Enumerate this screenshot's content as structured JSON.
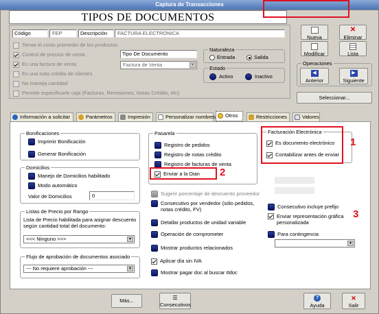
{
  "window": {
    "title": "Captura de Transacciones",
    "heading": "TIPOS DE DOCUMENTOS"
  },
  "header": {
    "codigo_label": "Código",
    "codigo_value": "FEP",
    "descripcion_label": "Descripción",
    "descripcion_value": "FACTURA ELECTRONICA"
  },
  "options": [
    {
      "label": "Tomar el costo promedio de los productos",
      "checked": false
    },
    {
      "label": "Control de precios de venta",
      "checked": true
    },
    {
      "label": "Es una factura de venta",
      "checked": true
    },
    {
      "label": "Es una nota crédito de clientes",
      "checked": false
    },
    {
      "label": "No maneja cantidad",
      "checked": false
    },
    {
      "label": "Permitir especificarle caja (Facturas, Remisiones, Notas Crédito, etc)",
      "checked": false
    }
  ],
  "tipo_documento": {
    "label": "Tipo De Documento",
    "value": "Factura de Venta"
  },
  "naturaleza": {
    "label": "Naturaleza",
    "options": [
      "Entrada",
      "Salida"
    ],
    "selected": "Salida"
  },
  "estado": {
    "label": "Estado",
    "options": [
      "Activo",
      "Inactivo"
    ]
  },
  "toolbar": {
    "nueva": "Nueva",
    "eliminar": "Eliminar",
    "modificar": "Modificar",
    "lista": "Lista"
  },
  "operaciones": {
    "label": "Operaciones",
    "anterior": "Anterior",
    "siguiente": "Siguiente"
  },
  "seleccionar": "Seleccionar...",
  "tabs": [
    "Información a solicitar",
    "Parámetros",
    "Impresión",
    "Personalizar nombres",
    "Otros",
    "Restricciones",
    "Valores"
  ],
  "bonificaciones": {
    "label": "Bonificaciones",
    "items": [
      "Imprimir Bonificación",
      "Generar Bonificación"
    ]
  },
  "domicilios": {
    "label": "Domicilios",
    "items": [
      "Manejo de Domicilios habilitado",
      "Modo automático"
    ],
    "valor_label": "Valor de Domicilios",
    "valor": "0"
  },
  "listas": {
    "label": "Listas de Precio por Rango",
    "desc": "Lista de Precio habilitada para asignar descuento según cantidad total del documento:",
    "value": "<<< Ninguno >>>"
  },
  "flujo": {
    "label": "Flujo de aprobación de documentos asociado",
    "value": "--- No requiere aprobación ---"
  },
  "pasarela": {
    "label": "Pasarela",
    "items": [
      "Registro de pedidos",
      "Registro de notas crédito",
      "Registro de facturas de venta"
    ],
    "dian": "Enviar a la Dian"
  },
  "mid_items": [
    "Sugerir porcentaje de descuento proveedor",
    "Consecutivo por vendedor (sólo pedidos, notas crédito, FV)",
    "Detallar productos de unidad variable",
    "Operación de comprometer",
    "Mostrar productos relacionados",
    "Aplicar día sin IVA",
    "Mostrar pagar doc al buscar #doc"
  ],
  "fe": {
    "label": "Facturación Electrónica",
    "items": [
      "Es documento electrónico",
      "Contabilizar antes de enviar"
    ]
  },
  "right_items": {
    "consecutivo": "Consecutivo incluye prefijo",
    "representacion": "Enviar representación gráfica personalizada",
    "contingencia": "Para contingencia"
  },
  "annotations": [
    "1",
    "2",
    "3"
  ],
  "footer": {
    "mas": "Más...",
    "consecutivos": "Consecutivos",
    "ayuda": "Ayuda",
    "salir": "Salir"
  }
}
